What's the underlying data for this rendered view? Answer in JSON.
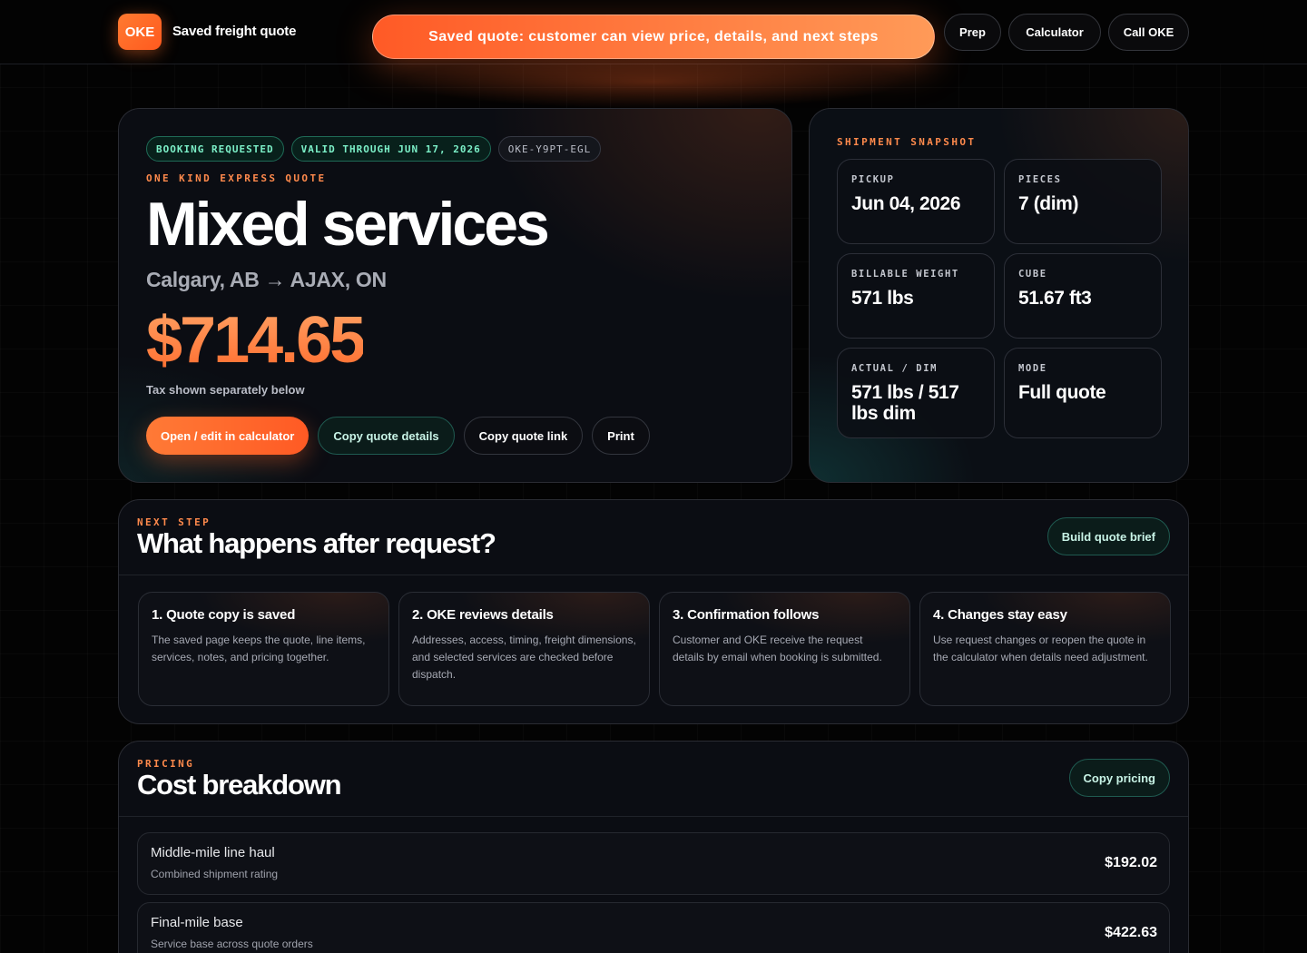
{
  "header": {
    "logo": "OKE",
    "title": "Saved freight quote",
    "banner": "Saved quote: customer can view price, details, and next steps",
    "nav": {
      "prep": "Prep",
      "calculator": "Calculator",
      "call": "Call OKE"
    }
  },
  "hero": {
    "badges": {
      "status": "BOOKING REQUESTED",
      "valid": "VALID THROUGH JUN 17, 2026",
      "id": "OKE-Y9PT-EGL"
    },
    "eyebrow": "ONE KIND EXPRESS QUOTE",
    "title": "Mixed services",
    "route": "Calgary, AB → AJAX, ON",
    "price": "$714.65",
    "tax_note": "Tax shown separately below",
    "actions": {
      "open": "Open / edit in calculator",
      "copy_details": "Copy quote details",
      "copy_link": "Copy quote link",
      "print": "Print"
    }
  },
  "snapshot": {
    "eyebrow": "SHIPMENT SNAPSHOT",
    "tiles": [
      {
        "label": "PICKUP",
        "value": "Jun 04, 2026"
      },
      {
        "label": "PIECES",
        "value": "7 (dim)"
      },
      {
        "label": "BILLABLE WEIGHT",
        "value": "571 lbs"
      },
      {
        "label": "CUBE",
        "value": "51.67 ft3"
      },
      {
        "label": "ACTUAL / DIM",
        "value": "571 lbs / 517 lbs dim"
      },
      {
        "label": "MODE",
        "value": "Full quote"
      }
    ]
  },
  "next_step": {
    "eyebrow": "NEXT STEP",
    "title": "What happens after request?",
    "button": "Build quote brief",
    "steps": [
      {
        "title": "1. Quote copy is saved",
        "body": "The saved page keeps the quote, line items, services, notes, and pricing together."
      },
      {
        "title": "2. OKE reviews details",
        "body": "Addresses, access, timing, freight dimensions, and selected services are checked before dispatch."
      },
      {
        "title": "3. Confirmation follows",
        "body": "Customer and OKE receive the request details by email when booking is submitted."
      },
      {
        "title": "4. Changes stay easy",
        "body": "Use request changes or reopen the quote in the calculator when details need adjustment."
      }
    ]
  },
  "pricing": {
    "eyebrow": "PRICING",
    "title": "Cost breakdown",
    "button": "Copy pricing",
    "rows": [
      {
        "name": "Middle-mile line haul",
        "sub": "Combined shipment rating",
        "amount": "$192.02"
      },
      {
        "name": "Final-mile base",
        "sub": "Service base across quote orders",
        "amount": "$422.63"
      }
    ]
  },
  "colors": {
    "accent": "#ff6a2c",
    "teal": "#7cf0c8",
    "background": "#030303"
  }
}
